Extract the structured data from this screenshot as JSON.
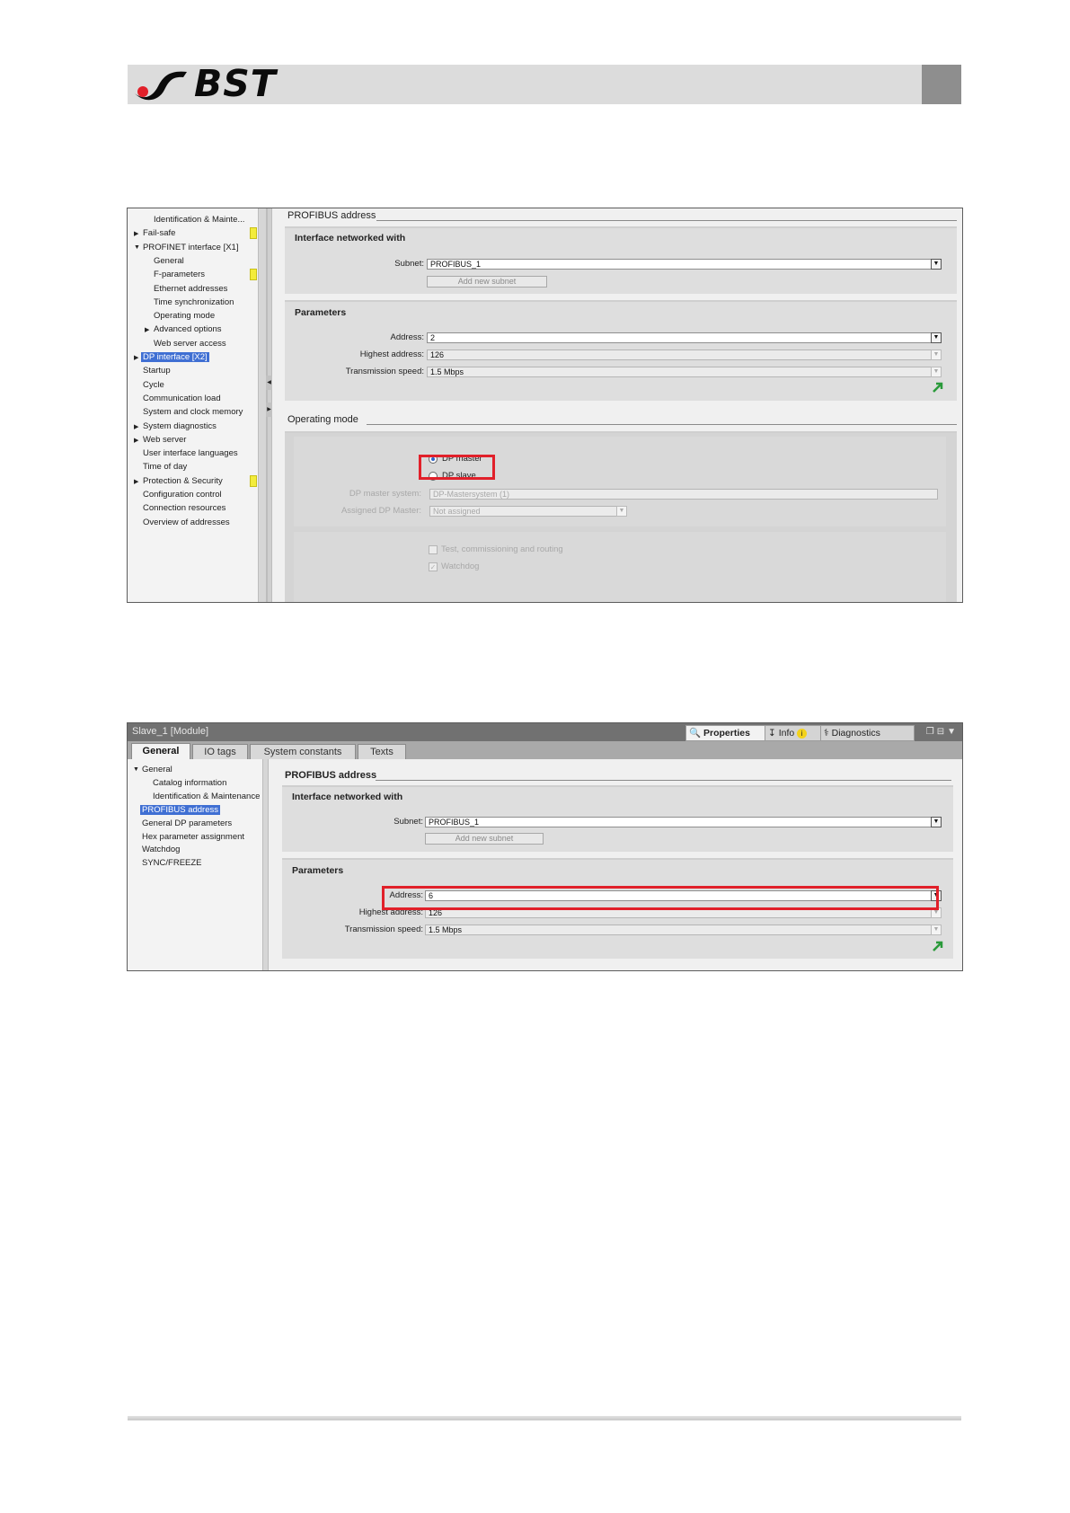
{
  "brand": {
    "name": "BST"
  },
  "colors": {
    "accent_red": "#e1202a",
    "selection_blue": "#3f6fd3",
    "marker_yellow": "#f3ec3b",
    "header_gray": "#dcdcdc"
  },
  "screenshot1": {
    "tree": [
      {
        "label": "Identification & Mainte...",
        "level": 2
      },
      {
        "label": "Fail-safe",
        "level": 1,
        "arrow": "right",
        "marker": true
      },
      {
        "label": "PROFINET interface [X1]",
        "level": 1,
        "arrow": "down"
      },
      {
        "label": "General",
        "level": 2
      },
      {
        "label": "F-parameters",
        "level": 2,
        "marker": true
      },
      {
        "label": "Ethernet addresses",
        "level": 2
      },
      {
        "label": "Time synchronization",
        "level": 2
      },
      {
        "label": "Operating mode",
        "level": 2
      },
      {
        "label": "Advanced options",
        "level": 2,
        "arrow": "right"
      },
      {
        "label": "Web server access",
        "level": 2
      },
      {
        "label": "DP interface [X2]",
        "level": 1,
        "arrow": "right",
        "selected": true
      },
      {
        "label": "Startup",
        "level": 1
      },
      {
        "label": "Cycle",
        "level": 1
      },
      {
        "label": "Communication load",
        "level": 1
      },
      {
        "label": "System and clock memory",
        "level": 1
      },
      {
        "label": "System diagnostics",
        "level": 1,
        "arrow": "right"
      },
      {
        "label": "Web server",
        "level": 1,
        "arrow": "right"
      },
      {
        "label": "User interface languages",
        "level": 1
      },
      {
        "label": "Time of day",
        "level": 1
      },
      {
        "label": "Protection & Security",
        "level": 1,
        "arrow": "right",
        "marker": true
      },
      {
        "label": "Configuration control",
        "level": 1
      },
      {
        "label": "Connection resources",
        "level": 1
      },
      {
        "label": "Overview of addresses",
        "level": 1
      }
    ],
    "profibus_title": "PROFIBUS address",
    "interface_title": "Interface networked with",
    "subnet_label": "Subnet:",
    "subnet_value": "PROFIBUS_1",
    "add_subnet_label": "Add new subnet",
    "parameters_title": "Parameters",
    "address_label": "Address:",
    "address_value": "2",
    "highest_label": "Highest address:",
    "highest_value": "126",
    "speed_label": "Transmission speed:",
    "speed_value": "1.5 Mbps",
    "operating_title": "Operating mode",
    "dp_master_label": "DP master",
    "dp_slave_label": "DP slave",
    "dp_master_system_label": "DP master system:",
    "dp_master_system_value": "DP-Mastersystem (1)",
    "assigned_master_label": "Assigned DP Master:",
    "assigned_master_value": "Not assigned",
    "test_label": "Test, commissioning and routing",
    "watchdog_label": "Watchdog"
  },
  "screenshot2": {
    "window_title": "Slave_1 [Module]",
    "inspector_tabs": [
      "Properties",
      "Info",
      "Diagnostics"
    ],
    "tabs": [
      "General",
      "IO tags",
      "System constants",
      "Texts"
    ],
    "tree": [
      {
        "label": "General",
        "level": 1,
        "arrow": "down"
      },
      {
        "label": "Catalog information",
        "level": 2
      },
      {
        "label": "Identification & Maintenance",
        "level": 2
      },
      {
        "label": "PROFIBUS address",
        "level": 1,
        "selected": true
      },
      {
        "label": "General DP parameters",
        "level": 1
      },
      {
        "label": "Hex parameter assignment",
        "level": 1
      },
      {
        "label": "Watchdog",
        "level": 1
      },
      {
        "label": "SYNC/FREEZE",
        "level": 1
      }
    ],
    "profibus_title": "PROFIBUS address",
    "interface_title": "Interface networked with",
    "subnet_label": "Subnet:",
    "subnet_value": "PROFIBUS_1",
    "add_subnet_label": "Add new subnet",
    "parameters_title": "Parameters",
    "address_label": "Address:",
    "address_value": "6",
    "highest_label": "Highest address:",
    "highest_value": "126",
    "speed_label": "Transmission speed:",
    "speed_value": "1.5 Mbps"
  }
}
